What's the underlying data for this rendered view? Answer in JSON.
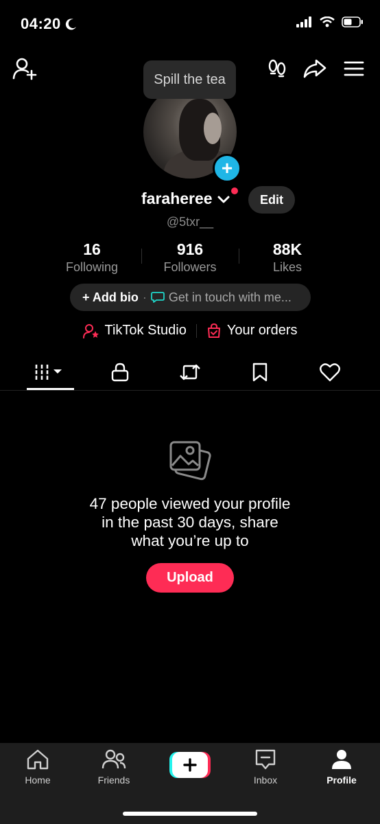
{
  "status_bar": {
    "time": "04:20"
  },
  "tooltip": "Spill the tea",
  "profile": {
    "username": "faraheree",
    "handle": "@5txr__",
    "edit_label": "Edit"
  },
  "stats": [
    {
      "value": "16",
      "label": "Following"
    },
    {
      "value": "916",
      "label": "Followers"
    },
    {
      "value": "88K",
      "label": "Likes"
    }
  ],
  "bio": {
    "add_label": "+ Add bio",
    "separator": "·",
    "contact_label": "Get in touch with me..."
  },
  "links": {
    "studio": "TikTok Studio",
    "orders": "Your orders"
  },
  "empty_state": {
    "line1": "47 people viewed your profile",
    "line2": "in the past 30 days, share",
    "line3": "what you’re up to",
    "upload_label": "Upload"
  },
  "bottom_nav": [
    {
      "label": "Home",
      "icon": "home-icon"
    },
    {
      "label": "Friends",
      "icon": "friends-icon"
    },
    {
      "label": "",
      "icon": "create-icon"
    },
    {
      "label": "Inbox",
      "icon": "inbox-icon"
    },
    {
      "label": "Profile",
      "icon": "profile-icon"
    }
  ],
  "colors": {
    "accent": "#fe2c55",
    "cyan": "#1fb6e6",
    "bar": "#1e1e1e"
  }
}
